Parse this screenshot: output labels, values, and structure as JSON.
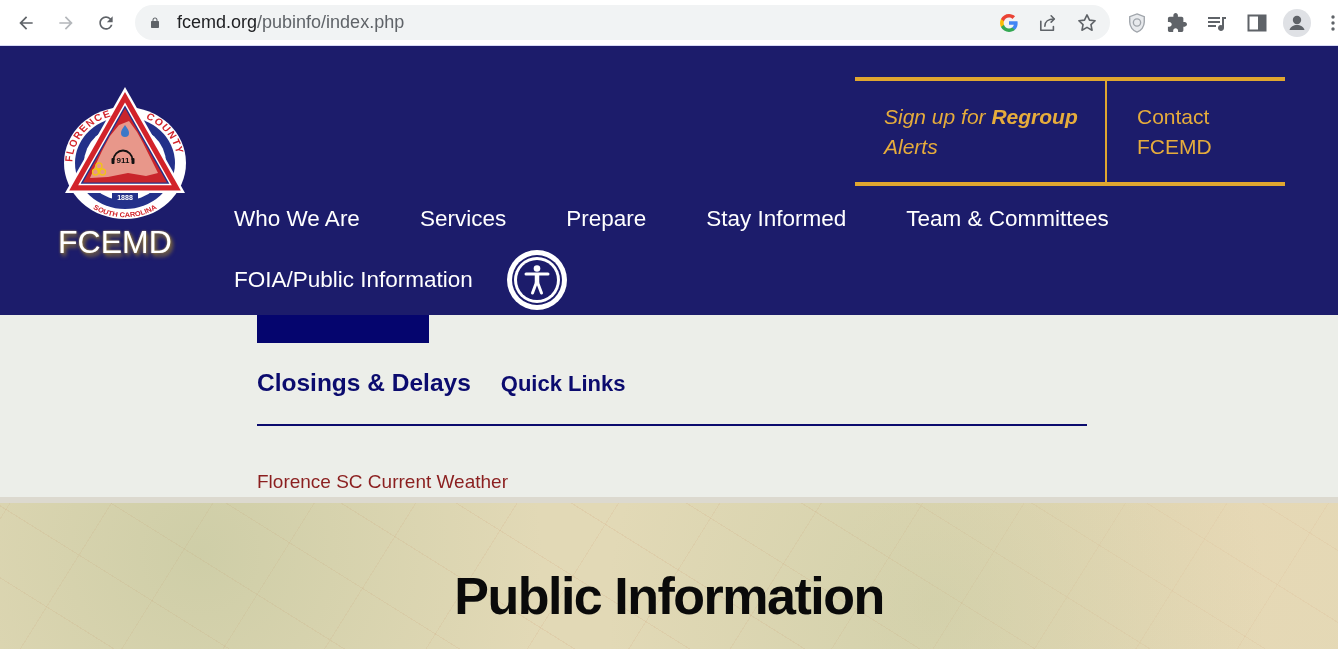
{
  "browser": {
    "nav_buttons": [
      {
        "kind": "back",
        "disabled": false
      },
      {
        "kind": "forward",
        "disabled": true
      },
      {
        "kind": "reload",
        "disabled": false
      }
    ],
    "address_bar": {
      "host": "fcemd.org",
      "path": "/pubinfo/index.php",
      "bookmarked": false
    }
  },
  "header": {
    "logo": {
      "seal": {
        "top_left_arc": "FLORENCE",
        "top_right_arc": "COUNTY",
        "badge": "911",
        "year": "1888",
        "bottom_arc": "SOUTH CAROLINA"
      },
      "wordmark": "FCEMD"
    },
    "alert_signup": "Sign up for **Regroup** Alerts",
    "contact_link": "Contact FCEMD",
    "nav": [
      "Who We Are",
      "Services",
      "Prepare",
      "Stay Informed",
      "Team & Committees",
      "FOIA/Public Information"
    ]
  },
  "content": {
    "section_links": [
      {
        "kind": "primary",
        "label": "Closings & Delays"
      },
      {
        "kind": "secondary",
        "label": "Quick Links"
      }
    ],
    "weather_link": "Florence SC Current Weather"
  },
  "hero": {
    "title": "Public Information"
  }
}
